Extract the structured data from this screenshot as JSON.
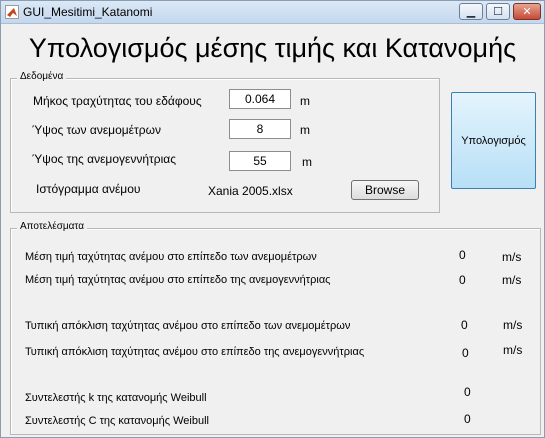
{
  "window": {
    "title": "GUI_Mesitimi_Katanomi"
  },
  "heading": "Υπολογισμός μέσης τιμής και Κατανομής",
  "inputs_panel": {
    "label": "Δεδομένα",
    "roughness": {
      "label": "Μήκος τραχύτητας του εδάφους",
      "value": "0.064",
      "unit": "m"
    },
    "anemometer_height": {
      "label": "Ύψος των ανεμομέτρων",
      "value": "8",
      "unit": "m"
    },
    "turbine_height": {
      "label": "Ύψος της ανεμογεννήτριας",
      "value": "55",
      "unit": "m"
    },
    "histogram": {
      "label": "Ιστόγραμμα ανέμου",
      "file": "Xania 2005.xlsx",
      "browse_label": "Browse"
    }
  },
  "compute_label": "Υπολογισμός",
  "results_panel": {
    "label": "Αποτελέσματα",
    "rows": [
      {
        "label": "Μέση τιμή ταχύτητας ανέμου στο επίπεδο των ανεμομέτρων",
        "value": "0",
        "unit": "m/s"
      },
      {
        "label": "Μέση τιμή ταχύτητας ανέμου στο επίπεδο της ανεμογεννήτριας",
        "value": "0",
        "unit": "m/s"
      },
      {
        "label": "Τυπική απόκλιση ταχύτητας ανέμου στο επίπεδο των ανεμομέτρων",
        "value": "0",
        "unit": "m/s"
      },
      {
        "label": "Τυπική απόκλιση ταχύτητας ανέμου στο επίπεδο της ανεμογεννήτριας",
        "value": "0",
        "unit": "m/s"
      },
      {
        "label": "Συντελεστής k της κατανομής Weibull",
        "value": "0",
        "unit": ""
      },
      {
        "label": "Συντελεστής C της κατανομής Weibull",
        "value": "0",
        "unit": ""
      }
    ]
  }
}
